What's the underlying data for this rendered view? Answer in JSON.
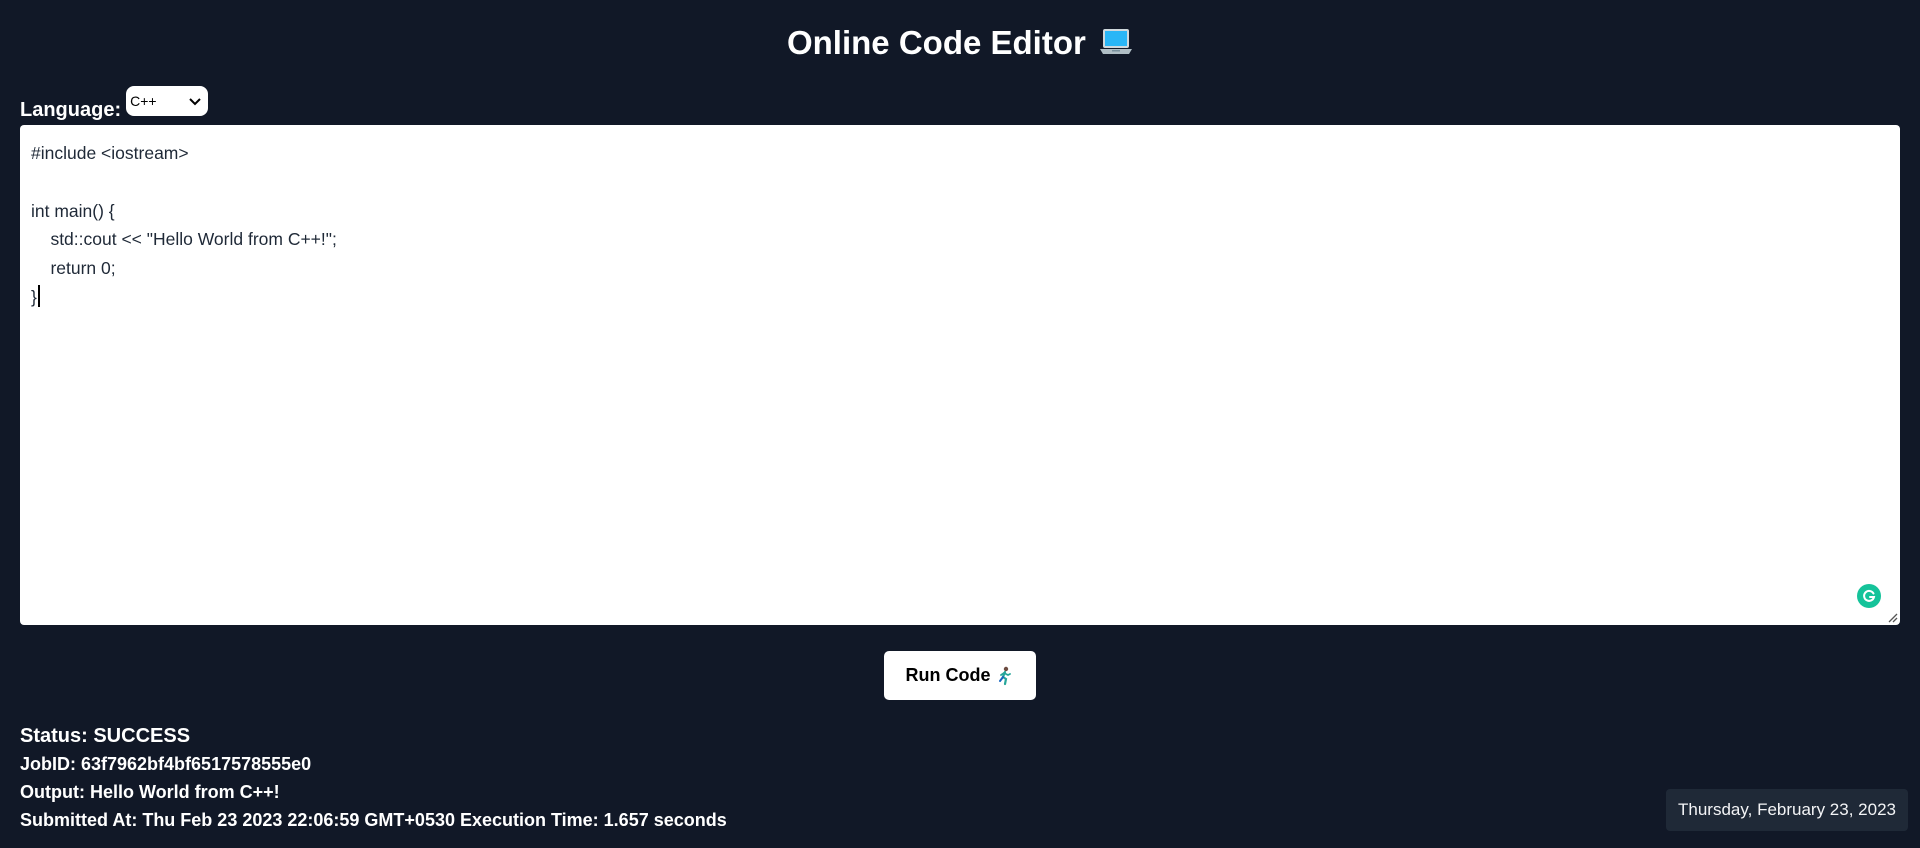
{
  "header": {
    "title": "Online Code Editor",
    "title_icon": "laptop-icon"
  },
  "language": {
    "label": "Language:",
    "selected": "C++"
  },
  "editor": {
    "lines": [
      "#include <iostream>",
      "",
      "int main() {",
      "    std::cout << \"Hello World from C++!\";",
      "    return 0;",
      "}"
    ]
  },
  "run_button": {
    "label": "Run Code",
    "icon": "running-person-icon"
  },
  "result": {
    "status": "Status: SUCCESS",
    "job_id": "JobID: 63f7962bf4bf6517578555e0",
    "output": "Output: Hello World from C++!",
    "submitted": "Submitted At: Thu Feb 23 2023 22:06:59 GMT+0530 Execution Time: 1.657 seconds"
  },
  "date_badge": "Thursday, February 23, 2023",
  "colors": {
    "background": "#111827",
    "editor_bg": "#ffffff",
    "grammarly": "#15c39a"
  }
}
